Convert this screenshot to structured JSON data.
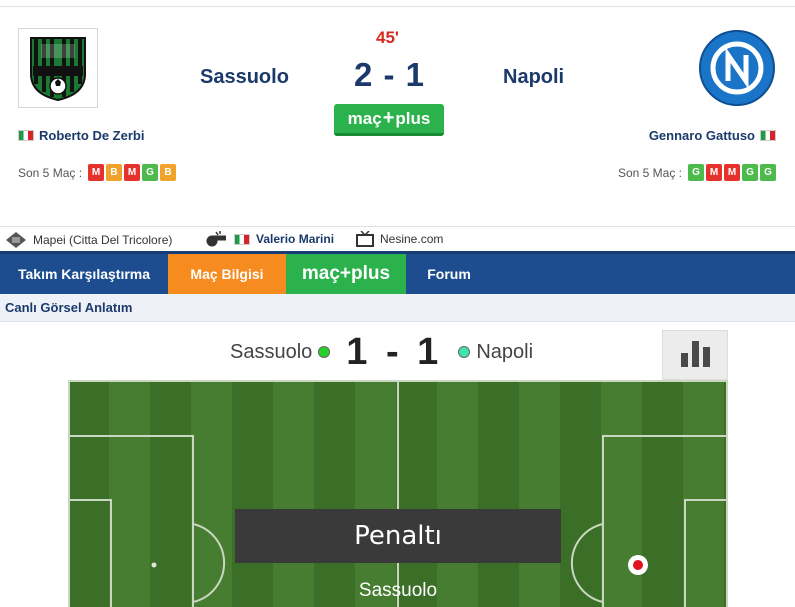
{
  "match": {
    "minute": "45'",
    "score": "2 - 1",
    "home": {
      "name": "Sassuolo",
      "coach": "Roberto De Zerbi",
      "form_label": "Son 5 Maç :",
      "form": [
        "M",
        "B",
        "M",
        "G",
        "B"
      ]
    },
    "away": {
      "name": "Napoli",
      "coach": "Gennaro Gattuso",
      "form_label": "Son 5 Maç :",
      "form": [
        "G",
        "M",
        "M",
        "G",
        "G"
      ]
    },
    "macplus_left": "maç",
    "macplus_plus": "+",
    "macplus_right": "plus"
  },
  "info": {
    "stadium": "Mapei (Citta Del Tricolore)",
    "referee": "Valerio Marini",
    "tv": "Nesine.com"
  },
  "tabs": [
    "Takım Karşılaştırma",
    "Maç Bilgisi",
    "maç+plus",
    "Forum"
  ],
  "section_title": "Canlı Görsel Anlatım",
  "live": {
    "home": "Sassuolo",
    "away": "Napoli",
    "score": "1 - 1",
    "event": "Penaltı",
    "event_team": "Sassuolo"
  },
  "colors": {
    "navy": "#1b3a6b",
    "tab_bar": "#1d4d8f",
    "orange": "#f68b1f",
    "green": "#2bb24c",
    "red": "#d62a1e"
  }
}
